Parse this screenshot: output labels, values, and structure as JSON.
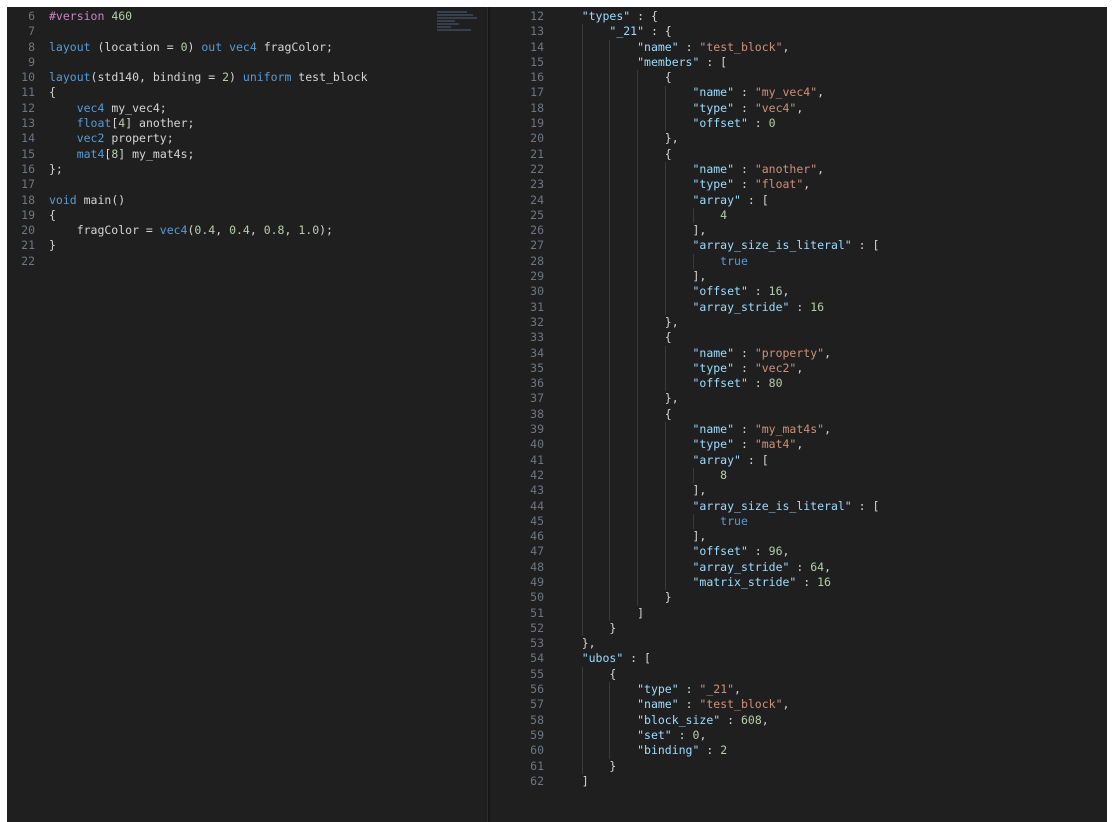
{
  "colors": {
    "background": "#1f1f1f",
    "line_number": "#6e7681",
    "default_text": "#d4d4d4",
    "keyword": "#569cd6",
    "json_key": "#9cdcfe",
    "string": "#ce9178",
    "number": "#b5cea8"
  },
  "left_editor": {
    "language": "glsl",
    "lines": [
      {
        "num": "6",
        "tokens": [
          {
            "t": "#version",
            "c": "pp"
          },
          {
            "t": " "
          },
          {
            "t": "460",
            "c": "num"
          }
        ]
      },
      {
        "num": "7",
        "tokens": []
      },
      {
        "num": "8",
        "tokens": [
          {
            "t": "layout",
            "c": "kw"
          },
          {
            "t": " (location = "
          },
          {
            "t": "0",
            "c": "num"
          },
          {
            "t": ") "
          },
          {
            "t": "out",
            "c": "kw"
          },
          {
            "t": " "
          },
          {
            "t": "vec4",
            "c": "kw"
          },
          {
            "t": " fragColor;"
          }
        ]
      },
      {
        "num": "9",
        "tokens": []
      },
      {
        "num": "10",
        "tokens": [
          {
            "t": "layout",
            "c": "kw"
          },
          {
            "t": "(std140, binding = "
          },
          {
            "t": "2",
            "c": "num"
          },
          {
            "t": ") "
          },
          {
            "t": "uniform",
            "c": "kw"
          },
          {
            "t": " test_block"
          }
        ]
      },
      {
        "num": "11",
        "tokens": [
          {
            "t": "{"
          }
        ]
      },
      {
        "num": "12",
        "tokens": [
          {
            "t": "    "
          },
          {
            "t": "vec4",
            "c": "kw"
          },
          {
            "t": " my_vec4;"
          }
        ]
      },
      {
        "num": "13",
        "tokens": [
          {
            "t": "    "
          },
          {
            "t": "float",
            "c": "kw"
          },
          {
            "t": "["
          },
          {
            "t": "4",
            "c": "num"
          },
          {
            "t": "] another;"
          }
        ]
      },
      {
        "num": "14",
        "tokens": [
          {
            "t": "    "
          },
          {
            "t": "vec2",
            "c": "kw"
          },
          {
            "t": " property;"
          }
        ]
      },
      {
        "num": "15",
        "tokens": [
          {
            "t": "    "
          },
          {
            "t": "mat4",
            "c": "kw"
          },
          {
            "t": "["
          },
          {
            "t": "8",
            "c": "num"
          },
          {
            "t": "] my_mat4s;"
          }
        ]
      },
      {
        "num": "16",
        "tokens": [
          {
            "t": "};"
          }
        ]
      },
      {
        "num": "17",
        "tokens": []
      },
      {
        "num": "18",
        "tokens": [
          {
            "t": "void",
            "c": "kw"
          },
          {
            "t": " main()"
          }
        ]
      },
      {
        "num": "19",
        "tokens": [
          {
            "t": "{"
          }
        ]
      },
      {
        "num": "20",
        "tokens": [
          {
            "t": "    fragColor = "
          },
          {
            "t": "vec4",
            "c": "kw"
          },
          {
            "t": "("
          },
          {
            "t": "0.4",
            "c": "num"
          },
          {
            "t": ", "
          },
          {
            "t": "0.4",
            "c": "num"
          },
          {
            "t": ", "
          },
          {
            "t": "0.8",
            "c": "num"
          },
          {
            "t": ", "
          },
          {
            "t": "1.0",
            "c": "num"
          },
          {
            "t": ");"
          }
        ]
      },
      {
        "num": "21",
        "tokens": [
          {
            "t": "}"
          }
        ]
      },
      {
        "num": "22",
        "tokens": []
      }
    ]
  },
  "right_editor": {
    "language": "json",
    "lines": [
      {
        "num": "12",
        "tokens": [
          {
            "t": "    "
          },
          {
            "t": "\"types\"",
            "c": "key"
          },
          {
            "t": " : {"
          }
        ]
      },
      {
        "num": "13",
        "tokens": [
          {
            "t": "        "
          },
          {
            "t": "\"_21\"",
            "c": "key"
          },
          {
            "t": " : {"
          }
        ]
      },
      {
        "num": "14",
        "tokens": [
          {
            "t": "            "
          },
          {
            "t": "\"name\"",
            "c": "key"
          },
          {
            "t": " : "
          },
          {
            "t": "\"test_block\"",
            "c": "str"
          },
          {
            "t": ","
          }
        ]
      },
      {
        "num": "15",
        "tokens": [
          {
            "t": "            "
          },
          {
            "t": "\"members\"",
            "c": "key"
          },
          {
            "t": " : ["
          }
        ]
      },
      {
        "num": "16",
        "tokens": [
          {
            "t": "                {"
          }
        ]
      },
      {
        "num": "17",
        "tokens": [
          {
            "t": "                    "
          },
          {
            "t": "\"name\"",
            "c": "key"
          },
          {
            "t": " : "
          },
          {
            "t": "\"my_vec4\"",
            "c": "str"
          },
          {
            "t": ","
          }
        ]
      },
      {
        "num": "18",
        "tokens": [
          {
            "t": "                    "
          },
          {
            "t": "\"type\"",
            "c": "key"
          },
          {
            "t": " : "
          },
          {
            "t": "\"vec4\"",
            "c": "str"
          },
          {
            "t": ","
          }
        ]
      },
      {
        "num": "19",
        "tokens": [
          {
            "t": "                    "
          },
          {
            "t": "\"offset\"",
            "c": "key"
          },
          {
            "t": " : "
          },
          {
            "t": "0",
            "c": "num"
          }
        ]
      },
      {
        "num": "20",
        "tokens": [
          {
            "t": "                },"
          }
        ]
      },
      {
        "num": "21",
        "tokens": [
          {
            "t": "                {"
          }
        ]
      },
      {
        "num": "22",
        "tokens": [
          {
            "t": "                    "
          },
          {
            "t": "\"name\"",
            "c": "key"
          },
          {
            "t": " : "
          },
          {
            "t": "\"another\"",
            "c": "str"
          },
          {
            "t": ","
          }
        ]
      },
      {
        "num": "23",
        "tokens": [
          {
            "t": "                    "
          },
          {
            "t": "\"type\"",
            "c": "key"
          },
          {
            "t": " : "
          },
          {
            "t": "\"float\"",
            "c": "str"
          },
          {
            "t": ","
          }
        ]
      },
      {
        "num": "24",
        "tokens": [
          {
            "t": "                    "
          },
          {
            "t": "\"array\"",
            "c": "key"
          },
          {
            "t": " : ["
          }
        ]
      },
      {
        "num": "25",
        "tokens": [
          {
            "t": "                        "
          },
          {
            "t": "4",
            "c": "num"
          }
        ]
      },
      {
        "num": "26",
        "tokens": [
          {
            "t": "                    ],"
          }
        ]
      },
      {
        "num": "27",
        "tokens": [
          {
            "t": "                    "
          },
          {
            "t": "\"array_size_is_literal\"",
            "c": "key"
          },
          {
            "t": " : ["
          }
        ]
      },
      {
        "num": "28",
        "tokens": [
          {
            "t": "                        "
          },
          {
            "t": "true",
            "c": "bool"
          }
        ]
      },
      {
        "num": "29",
        "tokens": [
          {
            "t": "                    ],"
          }
        ]
      },
      {
        "num": "30",
        "tokens": [
          {
            "t": "                    "
          },
          {
            "t": "\"offset\"",
            "c": "key"
          },
          {
            "t": " : "
          },
          {
            "t": "16",
            "c": "num"
          },
          {
            "t": ","
          }
        ]
      },
      {
        "num": "31",
        "tokens": [
          {
            "t": "                    "
          },
          {
            "t": "\"array_stride\"",
            "c": "key"
          },
          {
            "t": " : "
          },
          {
            "t": "16",
            "c": "num"
          }
        ]
      },
      {
        "num": "32",
        "tokens": [
          {
            "t": "                },"
          }
        ]
      },
      {
        "num": "33",
        "tokens": [
          {
            "t": "                {"
          }
        ]
      },
      {
        "num": "34",
        "tokens": [
          {
            "t": "                    "
          },
          {
            "t": "\"name\"",
            "c": "key"
          },
          {
            "t": " : "
          },
          {
            "t": "\"property\"",
            "c": "str"
          },
          {
            "t": ","
          }
        ]
      },
      {
        "num": "35",
        "tokens": [
          {
            "t": "                    "
          },
          {
            "t": "\"type\"",
            "c": "key"
          },
          {
            "t": " : "
          },
          {
            "t": "\"vec2\"",
            "c": "str"
          },
          {
            "t": ","
          }
        ]
      },
      {
        "num": "36",
        "tokens": [
          {
            "t": "                    "
          },
          {
            "t": "\"offset\"",
            "c": "key"
          },
          {
            "t": " : "
          },
          {
            "t": "80",
            "c": "num"
          }
        ]
      },
      {
        "num": "37",
        "tokens": [
          {
            "t": "                },"
          }
        ]
      },
      {
        "num": "38",
        "tokens": [
          {
            "t": "                {"
          }
        ]
      },
      {
        "num": "39",
        "tokens": [
          {
            "t": "                    "
          },
          {
            "t": "\"name\"",
            "c": "key"
          },
          {
            "t": " : "
          },
          {
            "t": "\"my_mat4s\"",
            "c": "str"
          },
          {
            "t": ","
          }
        ]
      },
      {
        "num": "40",
        "tokens": [
          {
            "t": "                    "
          },
          {
            "t": "\"type\"",
            "c": "key"
          },
          {
            "t": " : "
          },
          {
            "t": "\"mat4\"",
            "c": "str"
          },
          {
            "t": ","
          }
        ]
      },
      {
        "num": "41",
        "tokens": [
          {
            "t": "                    "
          },
          {
            "t": "\"array\"",
            "c": "key"
          },
          {
            "t": " : ["
          }
        ]
      },
      {
        "num": "42",
        "tokens": [
          {
            "t": "                        "
          },
          {
            "t": "8",
            "c": "num"
          }
        ]
      },
      {
        "num": "43",
        "tokens": [
          {
            "t": "                    ],"
          }
        ]
      },
      {
        "num": "44",
        "tokens": [
          {
            "t": "                    "
          },
          {
            "t": "\"array_size_is_literal\"",
            "c": "key"
          },
          {
            "t": " : ["
          }
        ]
      },
      {
        "num": "45",
        "tokens": [
          {
            "t": "                        "
          },
          {
            "t": "true",
            "c": "bool"
          }
        ]
      },
      {
        "num": "46",
        "tokens": [
          {
            "t": "                    ],"
          }
        ]
      },
      {
        "num": "47",
        "tokens": [
          {
            "t": "                    "
          },
          {
            "t": "\"offset\"",
            "c": "key"
          },
          {
            "t": " : "
          },
          {
            "t": "96",
            "c": "num"
          },
          {
            "t": ","
          }
        ]
      },
      {
        "num": "48",
        "tokens": [
          {
            "t": "                    "
          },
          {
            "t": "\"array_stride\"",
            "c": "key"
          },
          {
            "t": " : "
          },
          {
            "t": "64",
            "c": "num"
          },
          {
            "t": ","
          }
        ]
      },
      {
        "num": "49",
        "tokens": [
          {
            "t": "                    "
          },
          {
            "t": "\"matrix_stride\"",
            "c": "key"
          },
          {
            "t": " : "
          },
          {
            "t": "16",
            "c": "num"
          }
        ]
      },
      {
        "num": "50",
        "tokens": [
          {
            "t": "                }"
          }
        ]
      },
      {
        "num": "51",
        "tokens": [
          {
            "t": "            ]"
          }
        ]
      },
      {
        "num": "52",
        "tokens": [
          {
            "t": "        }"
          }
        ]
      },
      {
        "num": "53",
        "tokens": [
          {
            "t": "    },"
          }
        ]
      },
      {
        "num": "54",
        "tokens": [
          {
            "t": "    "
          },
          {
            "t": "\"ubos\"",
            "c": "key"
          },
          {
            "t": " : ["
          }
        ]
      },
      {
        "num": "55",
        "tokens": [
          {
            "t": "        {"
          }
        ]
      },
      {
        "num": "56",
        "tokens": [
          {
            "t": "            "
          },
          {
            "t": "\"type\"",
            "c": "key"
          },
          {
            "t": " : "
          },
          {
            "t": "\"_21\"",
            "c": "str"
          },
          {
            "t": ","
          }
        ]
      },
      {
        "num": "57",
        "tokens": [
          {
            "t": "            "
          },
          {
            "t": "\"name\"",
            "c": "key"
          },
          {
            "t": " : "
          },
          {
            "t": "\"test_block\"",
            "c": "str"
          },
          {
            "t": ","
          }
        ]
      },
      {
        "num": "58",
        "tokens": [
          {
            "t": "            "
          },
          {
            "t": "\"block_size\"",
            "c": "key"
          },
          {
            "t": " : "
          },
          {
            "t": "608",
            "c": "num"
          },
          {
            "t": ","
          }
        ]
      },
      {
        "num": "59",
        "tokens": [
          {
            "t": "            "
          },
          {
            "t": "\"set\"",
            "c": "key"
          },
          {
            "t": " : "
          },
          {
            "t": "0",
            "c": "num"
          },
          {
            "t": ","
          }
        ]
      },
      {
        "num": "60",
        "tokens": [
          {
            "t": "            "
          },
          {
            "t": "\"binding\"",
            "c": "key"
          },
          {
            "t": " : "
          },
          {
            "t": "2",
            "c": "num"
          }
        ]
      },
      {
        "num": "61",
        "tokens": [
          {
            "t": "        }"
          }
        ]
      },
      {
        "num": "62",
        "tokens": [
          {
            "t": "    ]"
          }
        ]
      }
    ]
  }
}
